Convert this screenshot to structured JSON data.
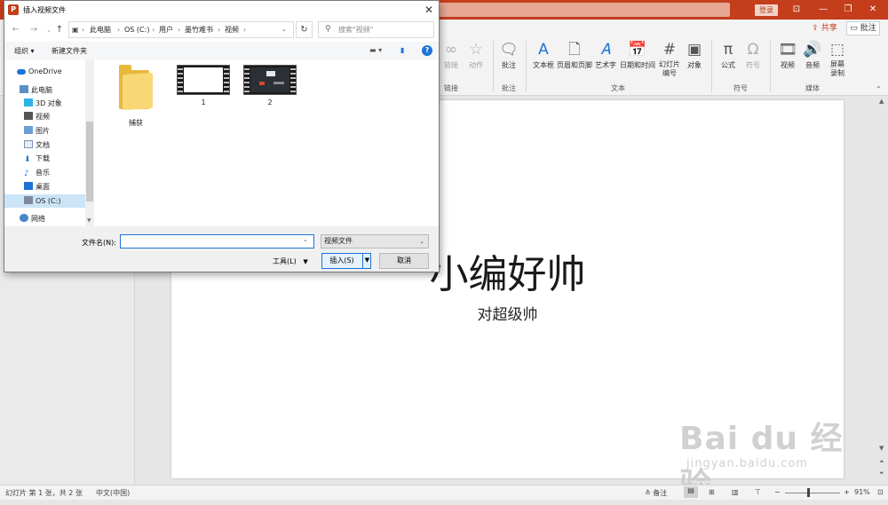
{
  "colors": {
    "ppt_accent": "#c43e1c",
    "selection": "#cce4f7",
    "focus": "#1e73d8",
    "folder": "#f8d775"
  },
  "ppt": {
    "login_label": "登录",
    "share_label": "共享",
    "comments_label": "批注",
    "ribbon": {
      "link": "链接",
      "action": "动作",
      "comment": "批注",
      "textbox": "文本框",
      "header_footer": "页眉和页脚",
      "wordart": "艺术字",
      "datetime": "日期和时间",
      "slide_number": "幻灯片\n编号",
      "object": "对象",
      "equation": "公式",
      "symbol": "符号",
      "video": "视频",
      "audio": "音频",
      "screen_record": "屏幕\n录制",
      "groups": {
        "links": "链接",
        "comments": "批注",
        "text": "文本",
        "symbols": "符号",
        "media": "媒体"
      }
    },
    "slide": {
      "title": "小编好帅",
      "subtitle": "对超级帅"
    },
    "status": {
      "slide_info": "幻灯片 第 1 张，共 2 张",
      "language": "中文(中国)",
      "notes": "备注",
      "zoom": "91%"
    }
  },
  "dialog": {
    "title": "插入视频文件",
    "address": [
      "此电脑",
      "OS (C:)",
      "用户",
      "墨竹难书",
      "视频"
    ],
    "search_placeholder": "搜索\"视频\"",
    "toolbar": {
      "organize": "组织 ▾",
      "new_folder": "新建文件夹"
    },
    "nav_tree": [
      {
        "label": "OneDrive",
        "icon": "cloud-icon"
      },
      {
        "label": "此电脑",
        "icon": "computer-icon"
      },
      {
        "label": "3D 对象",
        "icon": "cube-icon"
      },
      {
        "label": "视频",
        "icon": "video-icon"
      },
      {
        "label": "图片",
        "icon": "picture-icon"
      },
      {
        "label": "文档",
        "icon": "document-icon"
      },
      {
        "label": "下载",
        "icon": "download-icon"
      },
      {
        "label": "音乐",
        "icon": "music-icon"
      },
      {
        "label": "桌面",
        "icon": "desktop-icon"
      },
      {
        "label": "OS (C:)",
        "icon": "drive-icon"
      },
      {
        "label": "网络",
        "icon": "network-icon"
      }
    ],
    "files": [
      {
        "name": "捕获",
        "kind": "folder"
      },
      {
        "name": "1",
        "kind": "video"
      },
      {
        "name": "2",
        "kind": "video"
      }
    ],
    "filename_label": "文件名(N):",
    "filename_value": "",
    "filetype_value": "视频文件",
    "tools_label": "工具(L)",
    "insert_label": "插入(S)",
    "cancel_label": "取消"
  },
  "watermark": {
    "logo": "Bai du 经验",
    "url": "jingyan.baidu.com"
  }
}
